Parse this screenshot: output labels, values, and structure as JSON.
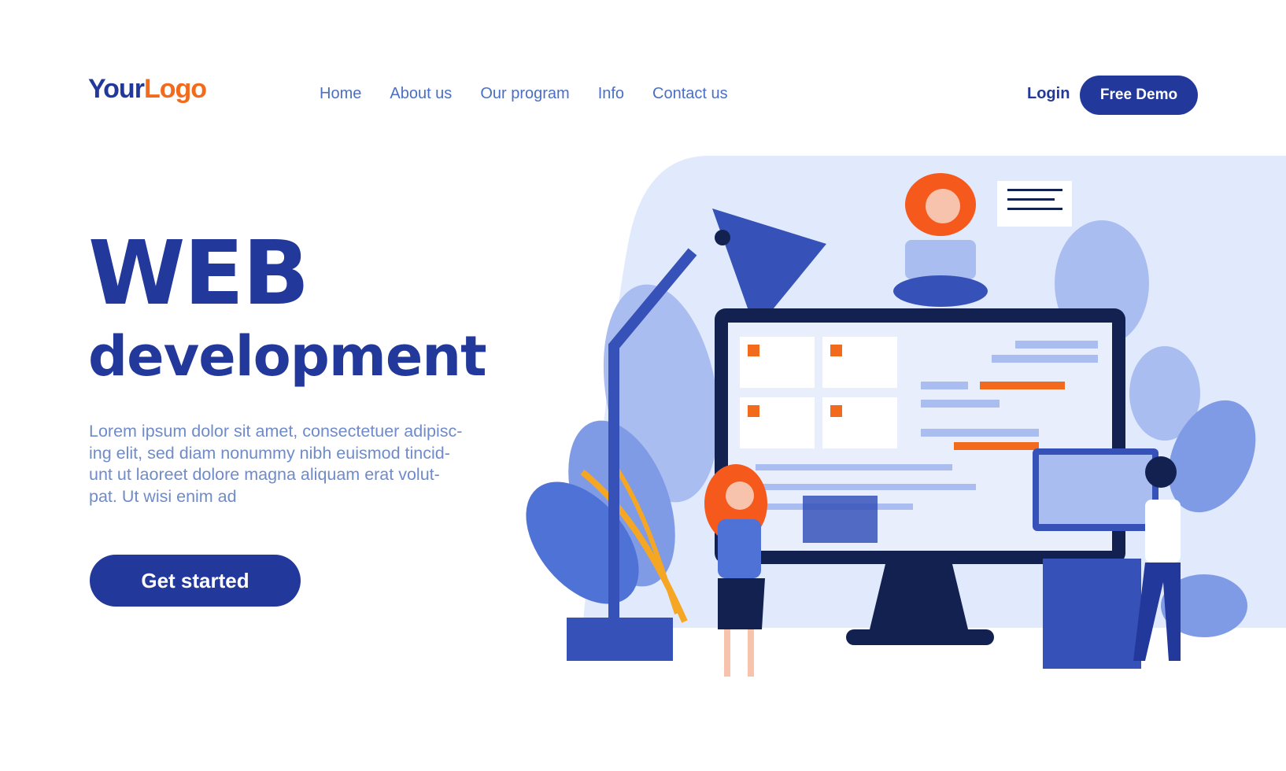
{
  "header": {
    "logo": {
      "part1": "Your",
      "part2": "Logo"
    },
    "nav": [
      {
        "label": "Home"
      },
      {
        "label": "About us"
      },
      {
        "label": "Our program"
      },
      {
        "label": "Info"
      },
      {
        "label": "Contact us"
      }
    ],
    "login_label": "Login",
    "demo_label": "Free Demo"
  },
  "hero": {
    "title": "WEB",
    "subtitle": "development",
    "paragraph_lines": [
      "Lorem ipsum dolor sit amet, consectetuer adipisc-",
      "ing elit, sed diam nonummy nibh euismod tincid-",
      "unt ut laoreet dolore magna aliquam erat volut-",
      "pat. Ut wisi enim ad"
    ],
    "cta_label": "Get started"
  },
  "colors": {
    "primary": "#22399b",
    "accent": "#f26a1b",
    "link": "#4b6fc4",
    "bg_panel": "#e1eafc"
  }
}
